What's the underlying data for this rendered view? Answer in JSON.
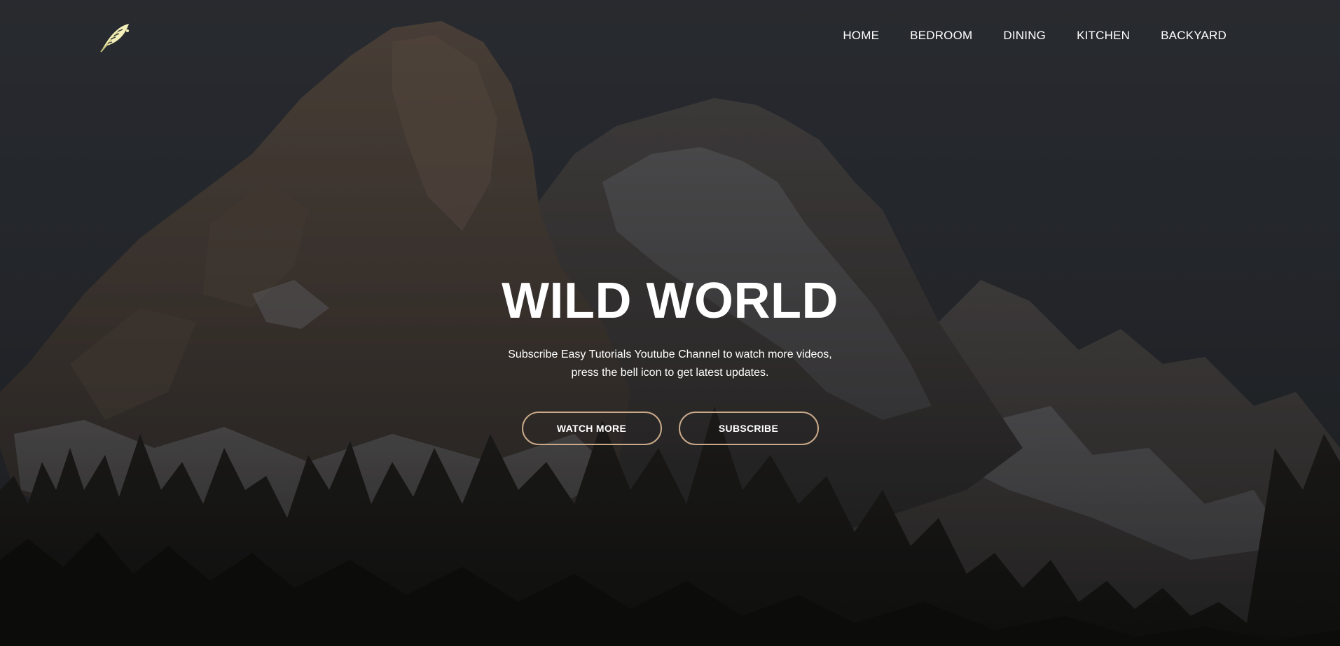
{
  "nav": {
    "logo_icon": "feather-icon",
    "items": [
      {
        "label": "HOME"
      },
      {
        "label": "BEDROOM"
      },
      {
        "label": "DINING"
      },
      {
        "label": "KITCHEN"
      },
      {
        "label": "BACKYARD"
      }
    ]
  },
  "hero": {
    "title": "WILD WORLD",
    "subtitle": "Subscribe Easy Tutorials Youtube Channel to watch more videos, press the bell icon to get latest updates.",
    "buttons": {
      "watch_more": "WATCH MORE",
      "subscribe": "SUBSCRIBE"
    }
  },
  "colors": {
    "button_border": "#c9a98a",
    "logo": "#f3efb8",
    "text": "#ffffff",
    "sky": "#2e3136"
  }
}
